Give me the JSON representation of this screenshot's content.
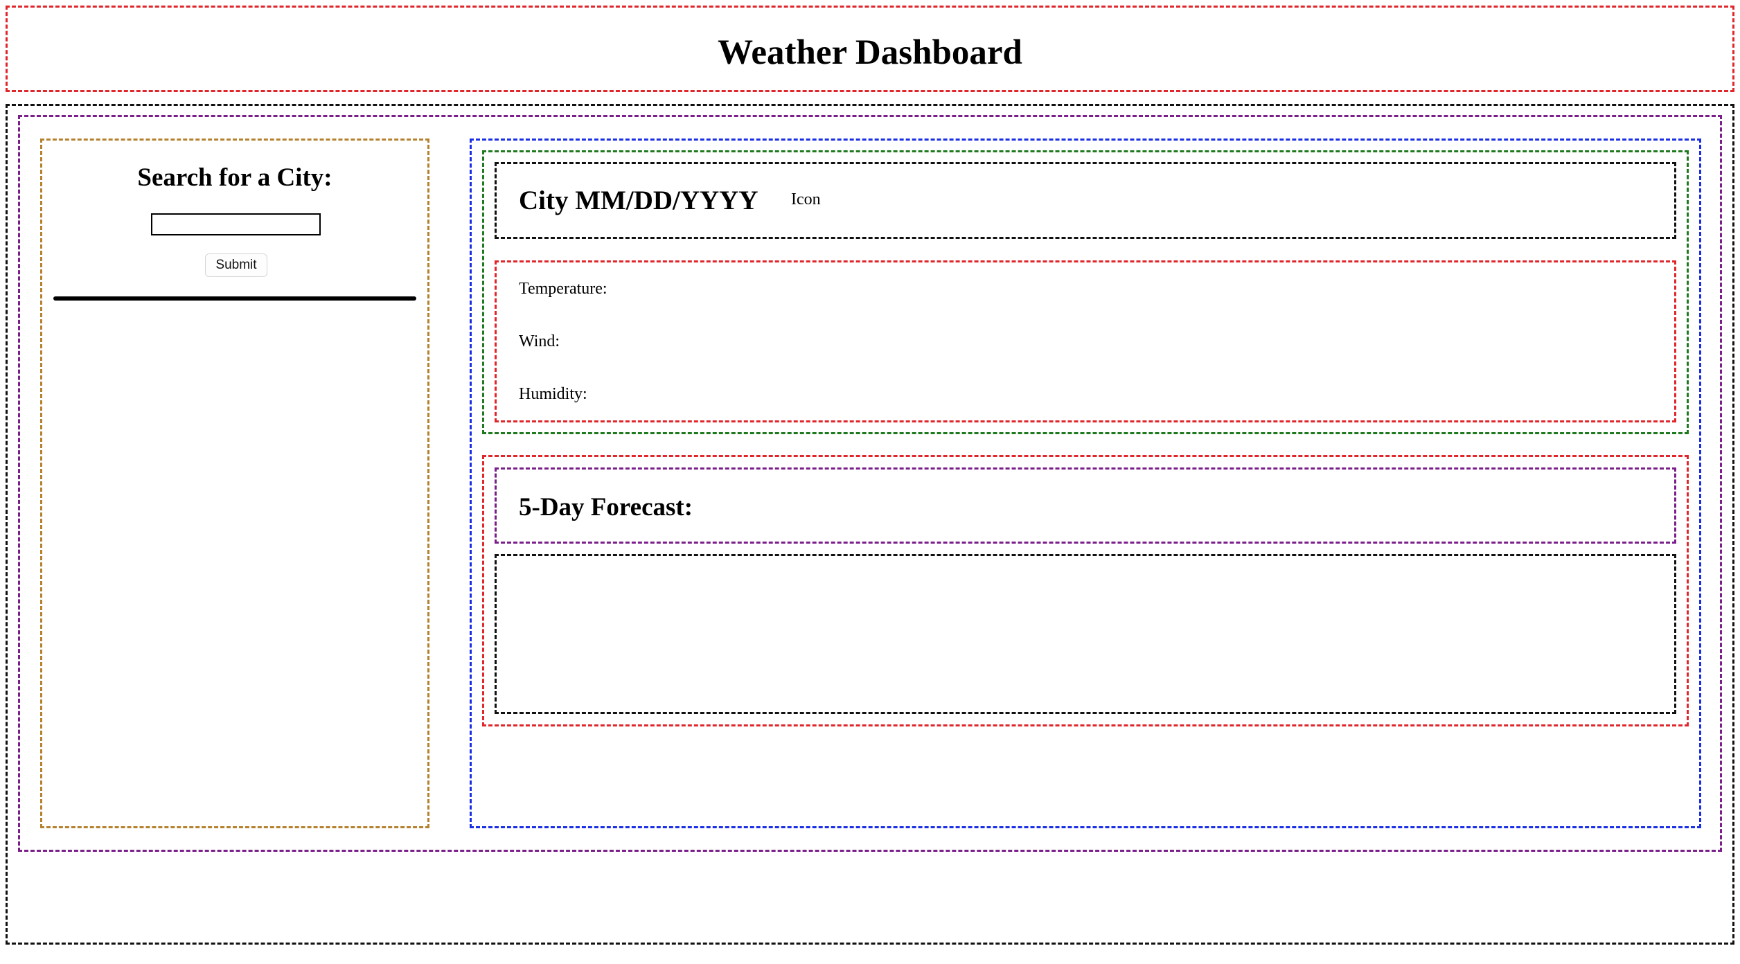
{
  "header": {
    "title": "Weather Dashboard"
  },
  "sidebar": {
    "search_title": "Search for a City:",
    "input_value": "",
    "submit_label": "Submit"
  },
  "current": {
    "city_date": "City MM/DD/YYYY",
    "icon_label": "Icon",
    "temperature_label": "Temperature:",
    "wind_label": "Wind:",
    "humidity_label": "Humidity:"
  },
  "forecast": {
    "title": "5-Day Forecast:",
    "cards": []
  },
  "colors": {
    "header_border": "#e0262b",
    "outer_border": "#111111",
    "container_border": "#7a1f8a",
    "sidebar_border": "#b5812e",
    "main_border": "#1a2ee6",
    "current_border": "#1f7a1f"
  }
}
